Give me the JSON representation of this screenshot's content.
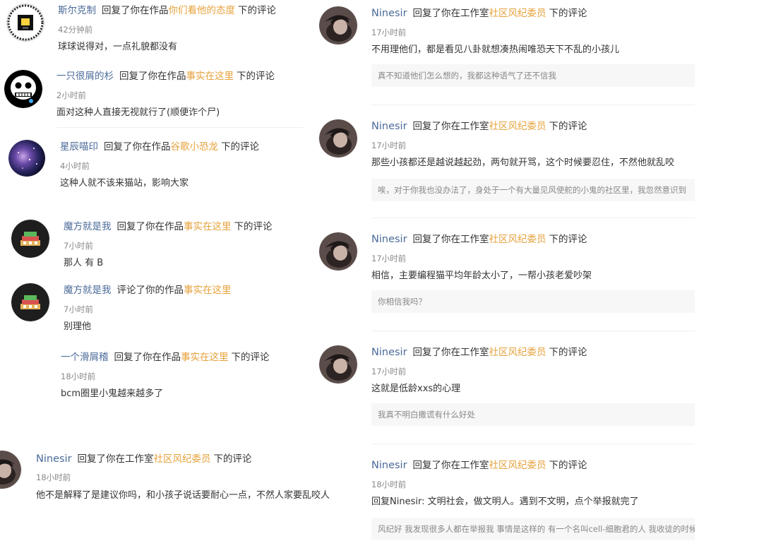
{
  "left_comments": [
    {
      "user": "斯尔克制",
      "action": "回复了你在作品",
      "work": "你们看他的态度",
      "suffix": "下的评论",
      "time": "42分钟前",
      "text": "球球说得对，一点礼貌都没有"
    },
    {
      "user": "一只很屑的杉",
      "action": "回复了你在作品",
      "work": "事实在这里",
      "suffix": "下的评论",
      "time": "2小时前",
      "text": "面对这种人直接无视就行了(顺便诈个尸)"
    },
    {
      "user": "星辰喵印",
      "action": "回复了你在作品",
      "work": "谷歌小恐龙",
      "suffix": "下的评论",
      "time": "4小时前",
      "text": "这种人就不该来猫站，影响大家"
    },
    {
      "user": "魔方就是我",
      "action": "回复了你在作品",
      "work": "事实在这里",
      "suffix": "下的评论",
      "time": "7小时前",
      "text": "那人 有  B"
    },
    {
      "user": "魔方就是我",
      "action": "评论了你的作品",
      "work": "事实在这里",
      "suffix": "",
      "time": "7小时前",
      "text": "别理他"
    },
    {
      "user": "一个滑屑稽",
      "action": "回复了你在作品",
      "work": "事实在这里",
      "suffix": "下的评论",
      "time": "18小时前",
      "text": "bcm圈里小鬼越来越多了"
    },
    {
      "user": "Ninesir",
      "action": "回复了你在工作室",
      "work": "社区风纪委员",
      "suffix": "下的评论",
      "time": "18小时前",
      "text": "他不是解释了是建议你吗，和小孩子说话要耐心一点，不然人家要乱咬人"
    }
  ],
  "right_comments": [
    {
      "user": "Ninesir",
      "action": "回复了你在工作室",
      "work": "社区风纪委员",
      "suffix": "下的评论",
      "time": "17小时前",
      "text": "不用理他们，都是看见八卦就想凑热闹唯恐天下不乱的小孩儿",
      "quote": "真不知道他们怎么想的，我都这种语气了还不信我"
    },
    {
      "user": "Ninesir",
      "action": "回复了你在工作室",
      "work": "社区风纪委员",
      "suffix": "下的评论",
      "time": "17小时前",
      "text": "那些小孩都还是越说越起劲，两句就开骂，这个时候要忍住，不然他就乱咬",
      "quote": "唉，对于你我也没办法了，身处于一个有大量见风使舵的小鬼的社区里，我忽然意识到"
    },
    {
      "user": "Ninesir",
      "action": "回复了你在工作室",
      "work": "社区风纪委员",
      "suffix": "下的评论",
      "time": "17小时前",
      "text": "相信，主要编程猫平均年龄太小了，一帮小孩老爱吵架",
      "quote": "你相信我吗？"
    },
    {
      "user": "Ninesir",
      "action": "回复了你在工作室",
      "work": "社区风纪委员",
      "suffix": "下的评论",
      "time": "17小时前",
      "text": "这就是低龄xxs的心理",
      "quote": "我真不明白撒谎有什么好处"
    },
    {
      "user": "Ninesir",
      "action": "回复了你在工作室",
      "work": "社区风纪委员",
      "suffix": "下的评论",
      "time": "18小时前",
      "text": "回复Ninesir:   文明社会，做文明人。遇到不文明，点个举报就完了",
      "quote": "风纪好 我发现很多人都在举报我 事情是这样的 有一个名叫cell-细胞君的人 我收徒的时候"
    }
  ]
}
